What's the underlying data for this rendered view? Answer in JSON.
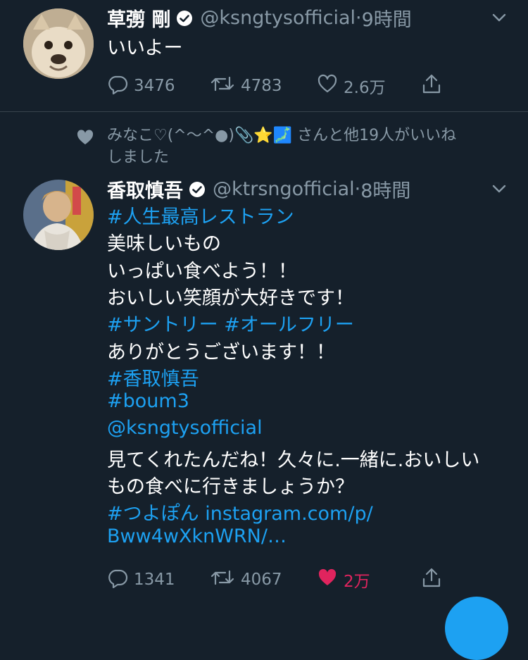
{
  "tweet1": {
    "name": "草彅 剛",
    "handle": "@ksngtysofficial",
    "time": "9時間",
    "text": "いいよー",
    "replies": "3476",
    "retweets": "4783",
    "likes": "2.6万"
  },
  "social_context": {
    "line1": "みなこ♡(^〜^●)📎⭐🗾 さんと他19人がいいね",
    "line2": "しました"
  },
  "tweet2": {
    "name": "香取慎吾",
    "handle": "@ktrsngofficial",
    "time": "8時間",
    "lines": [
      {
        "text": "#人生最高レストラン",
        "type": "link"
      },
      {
        "text": "美味しいもの",
        "type": "text"
      },
      {
        "text": "いっぱい食べよう！！",
        "type": "text"
      },
      {
        "text": "おいしい笑顔が大好きです！",
        "type": "text"
      },
      {
        "text": "#サントリー #オールフリー",
        "type": "link"
      },
      {
        "text": "ありがとうございます！！",
        "type": "text"
      },
      {
        "text": "#香取慎吾",
        "type": "link"
      },
      {
        "text": "#boum3",
        "type": "link"
      },
      {
        "text": "@ksngtysofficial",
        "type": "link"
      },
      {
        "text": "見てくれたんだね！久々に.一緒に.おいしい",
        "type": "text"
      },
      {
        "text": "もの食べに行きましょうか？",
        "type": "text"
      },
      {
        "text": "#つよぽん instagram.com/p/",
        "type": "link"
      },
      {
        "text": "Bww4wXknWRN/…",
        "type": "link"
      }
    ],
    "replies": "1341",
    "retweets": "4067",
    "likes": "2万"
  },
  "colors": {
    "background": "#15202b",
    "link": "#1da1f2",
    "secondary": "#8899a6",
    "like_active": "#e0245e"
  }
}
